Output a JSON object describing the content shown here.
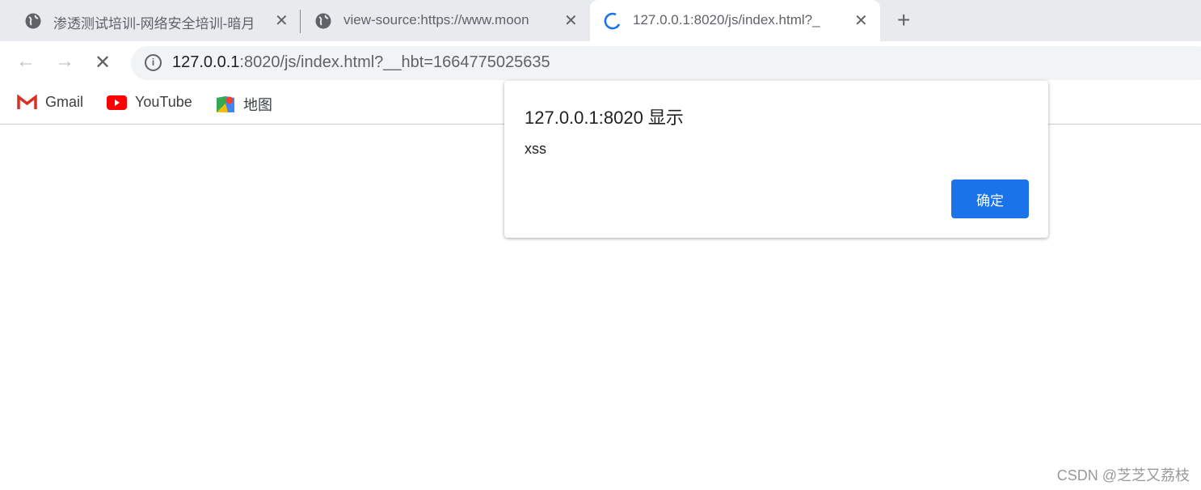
{
  "tabs": [
    {
      "title": "渗透测试培训-网络安全培训-暗月",
      "icon": "globe-icon"
    },
    {
      "title": "view-source:https://www.moon",
      "icon": "globe-icon"
    },
    {
      "title": "127.0.0.1:8020/js/index.html?_",
      "icon": "loading-spinner-icon",
      "active": true
    }
  ],
  "address": {
    "host": "127.0.0.1",
    "rest": ":8020/js/index.html?__hbt=1664775025635"
  },
  "bookmarks": [
    {
      "label": "Gmail"
    },
    {
      "label": "YouTube"
    },
    {
      "label": "地图"
    }
  ],
  "dialog": {
    "title": "127.0.0.1:8020 显示",
    "message": "xss",
    "ok_label": "确定"
  },
  "watermark": "CSDN @芝芝又荔枝",
  "colors": {
    "accent": "#1a73e8",
    "tabstrip": "#e8eaed"
  }
}
